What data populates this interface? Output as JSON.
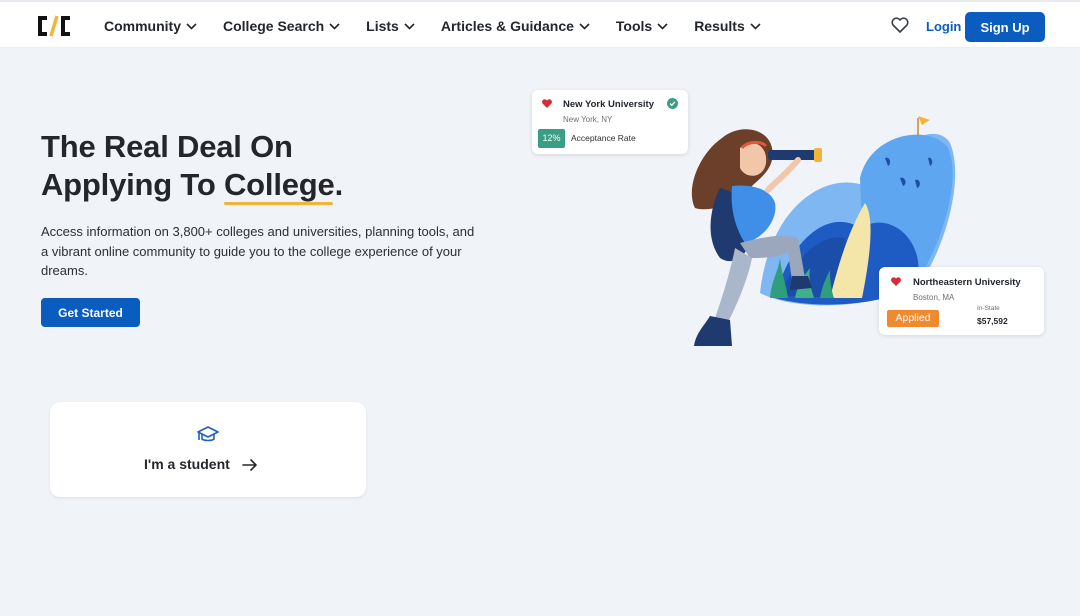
{
  "header": {
    "logo_text": "C/C",
    "nav": [
      {
        "label": "Community"
      },
      {
        "label": "College Search"
      },
      {
        "label": "Lists"
      },
      {
        "label": "Articles & Guidance"
      },
      {
        "label": "Tools"
      },
      {
        "label": "Results"
      }
    ],
    "login_label": "Login",
    "signup_label": "Sign Up"
  },
  "hero": {
    "title_line1": "The Real Deal On",
    "title_line2_prefix": "Applying To ",
    "title_highlight": "College",
    "title_suffix": ".",
    "description": "Access information on 3,800+ colleges and universities, planning tools, and a vibrant online community to guide you to the college experience of your dreams.",
    "cta_label": "Get Started"
  },
  "student_card": {
    "label": "I'm a student",
    "icon": "graduation-cap-icon"
  },
  "college_cards": [
    {
      "name": "New York University",
      "location": "New York, NY",
      "badge": "12%",
      "badge_label": "Acceptance Rate",
      "verified": true
    },
    {
      "name": "Northeastern University",
      "location": "Boston, MA",
      "status": "Applied",
      "cost_label": "In-State",
      "cost_value": "$57,592"
    }
  ],
  "colors": {
    "brand_blue": "#0b5cbf",
    "highlight_yellow": "#f2b53c",
    "badge_green": "#3a9d86",
    "badge_orange": "#ef8a2e",
    "heart_red": "#d62b3a",
    "page_bg": "#f0f3f7"
  }
}
